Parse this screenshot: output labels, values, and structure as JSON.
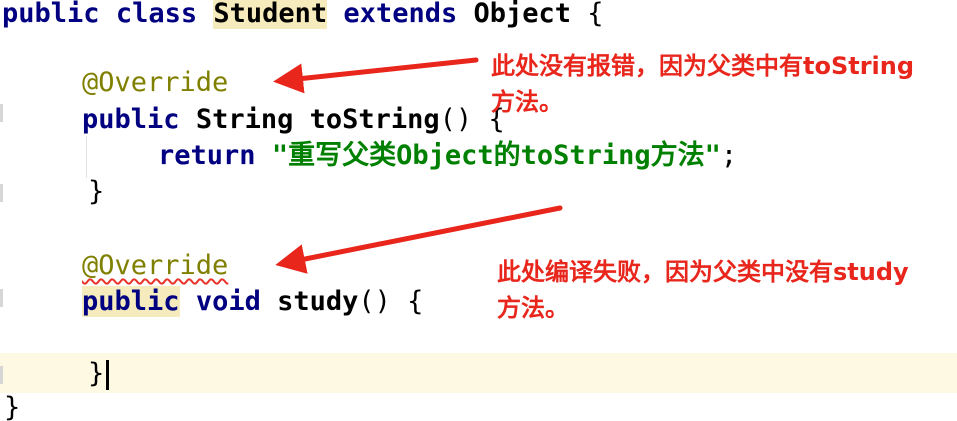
{
  "code": {
    "kw_public": "public",
    "kw_class": "class",
    "class_name": "Student",
    "kw_extends": "extends",
    "super_name": "Object",
    "brace_open": "{",
    "brace_close": "}",
    "annotation": "@Override",
    "kw_string_type": "String",
    "method_tostring": "toString",
    "parens": "()",
    "kw_return": "return",
    "string_literal": "\"重写父类Object的toString方法\"",
    "semicolon": ";",
    "kw_void": "void",
    "method_study": "study"
  },
  "notes": {
    "note1_line1": "此处没有报错，因为父类中有toString",
    "note1_line2": "方法。",
    "note2_line1": "此处编译失败，因为父类中没有study",
    "note2_line2": "方法。"
  },
  "colors": {
    "keyword": "#000080",
    "annotation": "#808000",
    "string": "#008000",
    "note_red": "#e8261c",
    "highlight": "#f6ebbc",
    "caret_line": "#fdf9e3"
  }
}
